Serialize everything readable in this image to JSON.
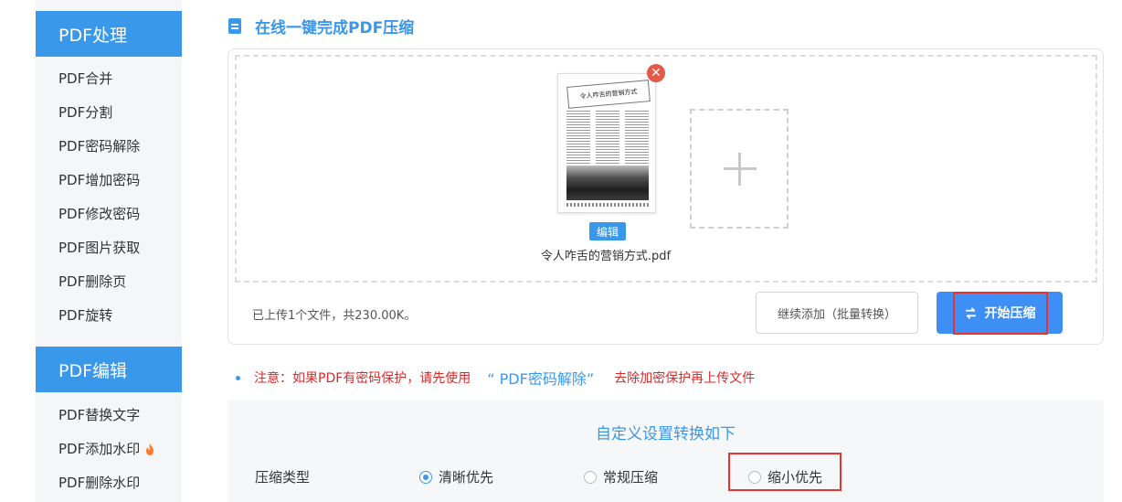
{
  "sidebar": {
    "sections": [
      {
        "title": "PDF处理",
        "items": [
          "PDF合并",
          "PDF分割",
          "PDF密码解除",
          "PDF增加密码",
          "PDF修改密码",
          "PDF图片获取",
          "PDF删除页",
          "PDF旋转"
        ]
      },
      {
        "title": "PDF编辑",
        "items": [
          "PDF替换文字",
          "PDF添加水印",
          "PDF删除水印"
        ]
      }
    ],
    "hot_icon": "fire-icon"
  },
  "main": {
    "title": "在线一键完成PDF压缩",
    "file": {
      "name": "令人咋舌的营销方式.pdf",
      "thumb_heading": "令人咋舌的营销方式",
      "edit_label": "编辑",
      "remove_label": "✕"
    },
    "add_icon": "plus-icon",
    "status": "已上传1个文件，共230.00K。",
    "continue_label": "继续添加（批量转换）",
    "start_label": "开始压缩",
    "start_icon": "swap-icon",
    "notice": {
      "prefix": "注意：如果PDF有密码保护，请先使用",
      "link": "“ PDF密码解除”",
      "suffix": "去除加密保护再上传文件"
    },
    "settings": {
      "title": "自定义设置转换如下",
      "compress_label": "压缩类型",
      "options": [
        "清晰优先",
        "常规压缩",
        "缩小优先"
      ],
      "selected": "清晰优先"
    }
  },
  "colors": {
    "accent": "#3a98ea",
    "highlight": "#e63333",
    "warning": "#d62b2b"
  }
}
